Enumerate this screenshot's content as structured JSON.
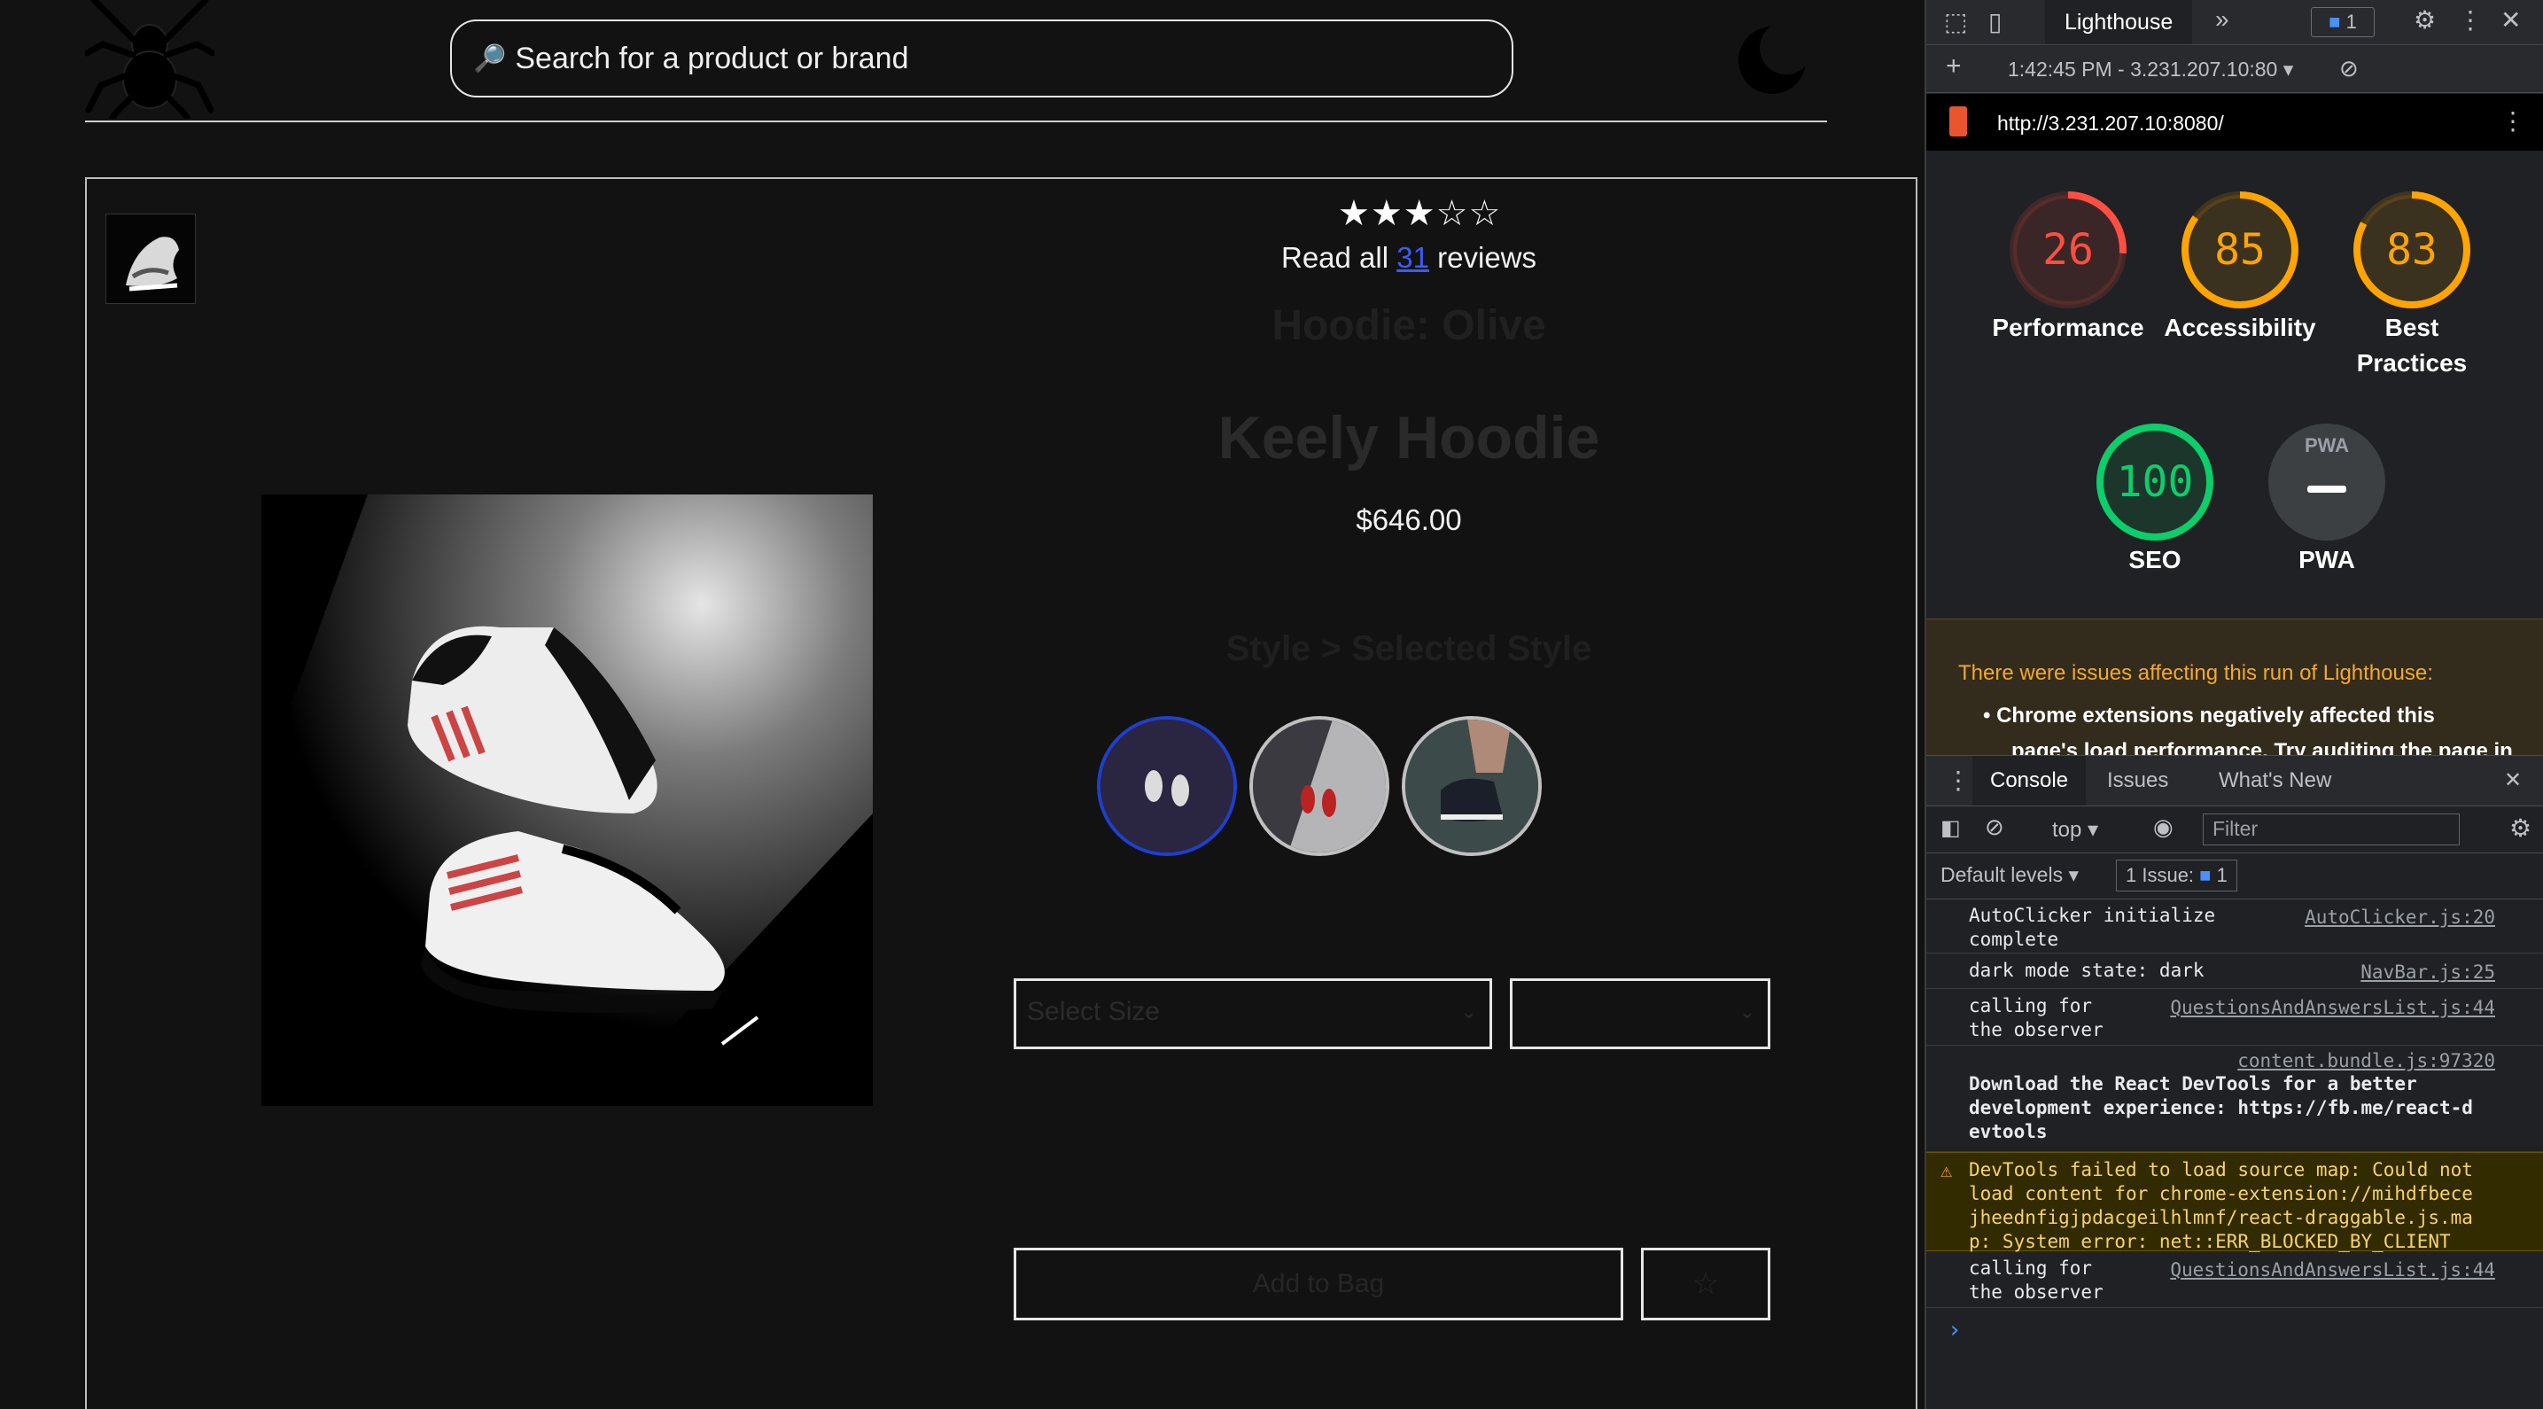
{
  "header": {
    "search_placeholder": "Search for a product or brand"
  },
  "product": {
    "rating": 3,
    "rating_max": 5,
    "reviews_prefix": "Read all",
    "reviews_count": "31",
    "reviews_suffix": "reviews",
    "category": "Hoodie: Olive",
    "name": "Keely Hoodie",
    "price": "$646.00",
    "style_label": "Style > Selected Style",
    "size_placeholder": "Select Size",
    "add_to_bag": "Add to Bag",
    "favorite_glyph": "☆"
  },
  "devtools": {
    "active_tab": "Lighthouse",
    "issues_badge": "1",
    "report_time": "1:42:45 PM - 3.231.207.10:80",
    "url": "http://3.231.207.10:8080/",
    "scores": [
      {
        "label": "Performance",
        "value": 26,
        "color": "#ff4e42"
      },
      {
        "label": "Accessibility",
        "value": 85,
        "color": "#ffa400"
      },
      {
        "label": "Best Practices",
        "value": 83,
        "color": "#ffa400"
      },
      {
        "label": "SEO",
        "value": 100,
        "color": "#0cce6b"
      },
      {
        "label": "PWA",
        "value": null,
        "color": "#9aa0a6"
      }
    ],
    "pwa_badge": "PWA",
    "warning_title": "There were issues affecting this run of Lighthouse:",
    "warning_item": "Chrome extensions negatively affected this",
    "warning_item_cont": "page's load performance. Try auditing the page in",
    "console_tabs": [
      "Console",
      "Issues",
      "What's New"
    ],
    "context": "top",
    "filter_placeholder": "Filter",
    "levels": "Default levels",
    "issue_chip_label": "1 Issue:",
    "issue_chip_count": "1",
    "logs": [
      {
        "msg": "AutoClicker initialize\ncomplete",
        "src": "AutoClicker.js:20"
      },
      {
        "msg": "dark mode state: dark",
        "src": "NavBar.js:25"
      },
      {
        "msg": "calling for\nthe observer",
        "src": "QuestionsAndAnswersList.js:44"
      },
      {
        "msg": "Download the React DevTools for a better\ndevelopment experience: https://fb.me/react-d\nevtools",
        "src": "content.bundle.js:97320"
      },
      {
        "msg": "DevTools failed to load source map: Could not\nload content for chrome-extension://mihdfbece\njheednfigjpdacgeilhlmnf/react-draggable.js.ma\np: System error: net::ERR_BLOCKED_BY_CLIENT",
        "src": ""
      },
      {
        "msg": "calling for\nthe observer",
        "src": "QuestionsAndAnswersList.js:44"
      }
    ],
    "prompt": "›"
  }
}
